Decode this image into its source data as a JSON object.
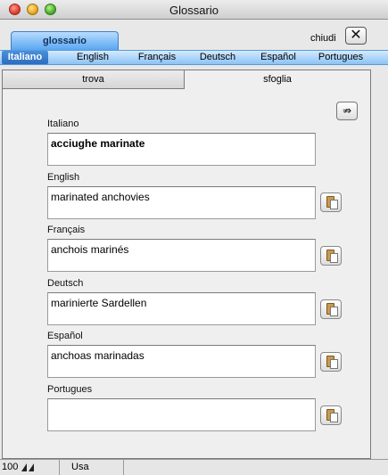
{
  "window": {
    "title": "Glossario"
  },
  "toolbar": {
    "tab_label": "glossario",
    "close_label": "chiudi",
    "close_button_glyph": "✕"
  },
  "languages": [
    "Italiano",
    "English",
    "Français",
    "Deutsch",
    "Español",
    "Portugues"
  ],
  "active_language": "Italiano",
  "subtabs": {
    "trova": "trova",
    "sfoglia": "sfoglia"
  },
  "export_icon": "export-arrow-icon",
  "fields": [
    {
      "label": "Italiano",
      "value": "acciughe marinate"
    },
    {
      "label": "English",
      "value": "marinated anchovies"
    },
    {
      "label": "Français",
      "value": "anchois marinés"
    },
    {
      "label": "Deutsch",
      "value": "marinierte Sardellen"
    },
    {
      "label": "Español",
      "value": "anchoas marinadas"
    },
    {
      "label": "Portugues",
      "value": ""
    }
  ],
  "copy_icon": "paste-clipboard-icon",
  "statusbar": {
    "zoom": "100",
    "mode": "Usa"
  }
}
